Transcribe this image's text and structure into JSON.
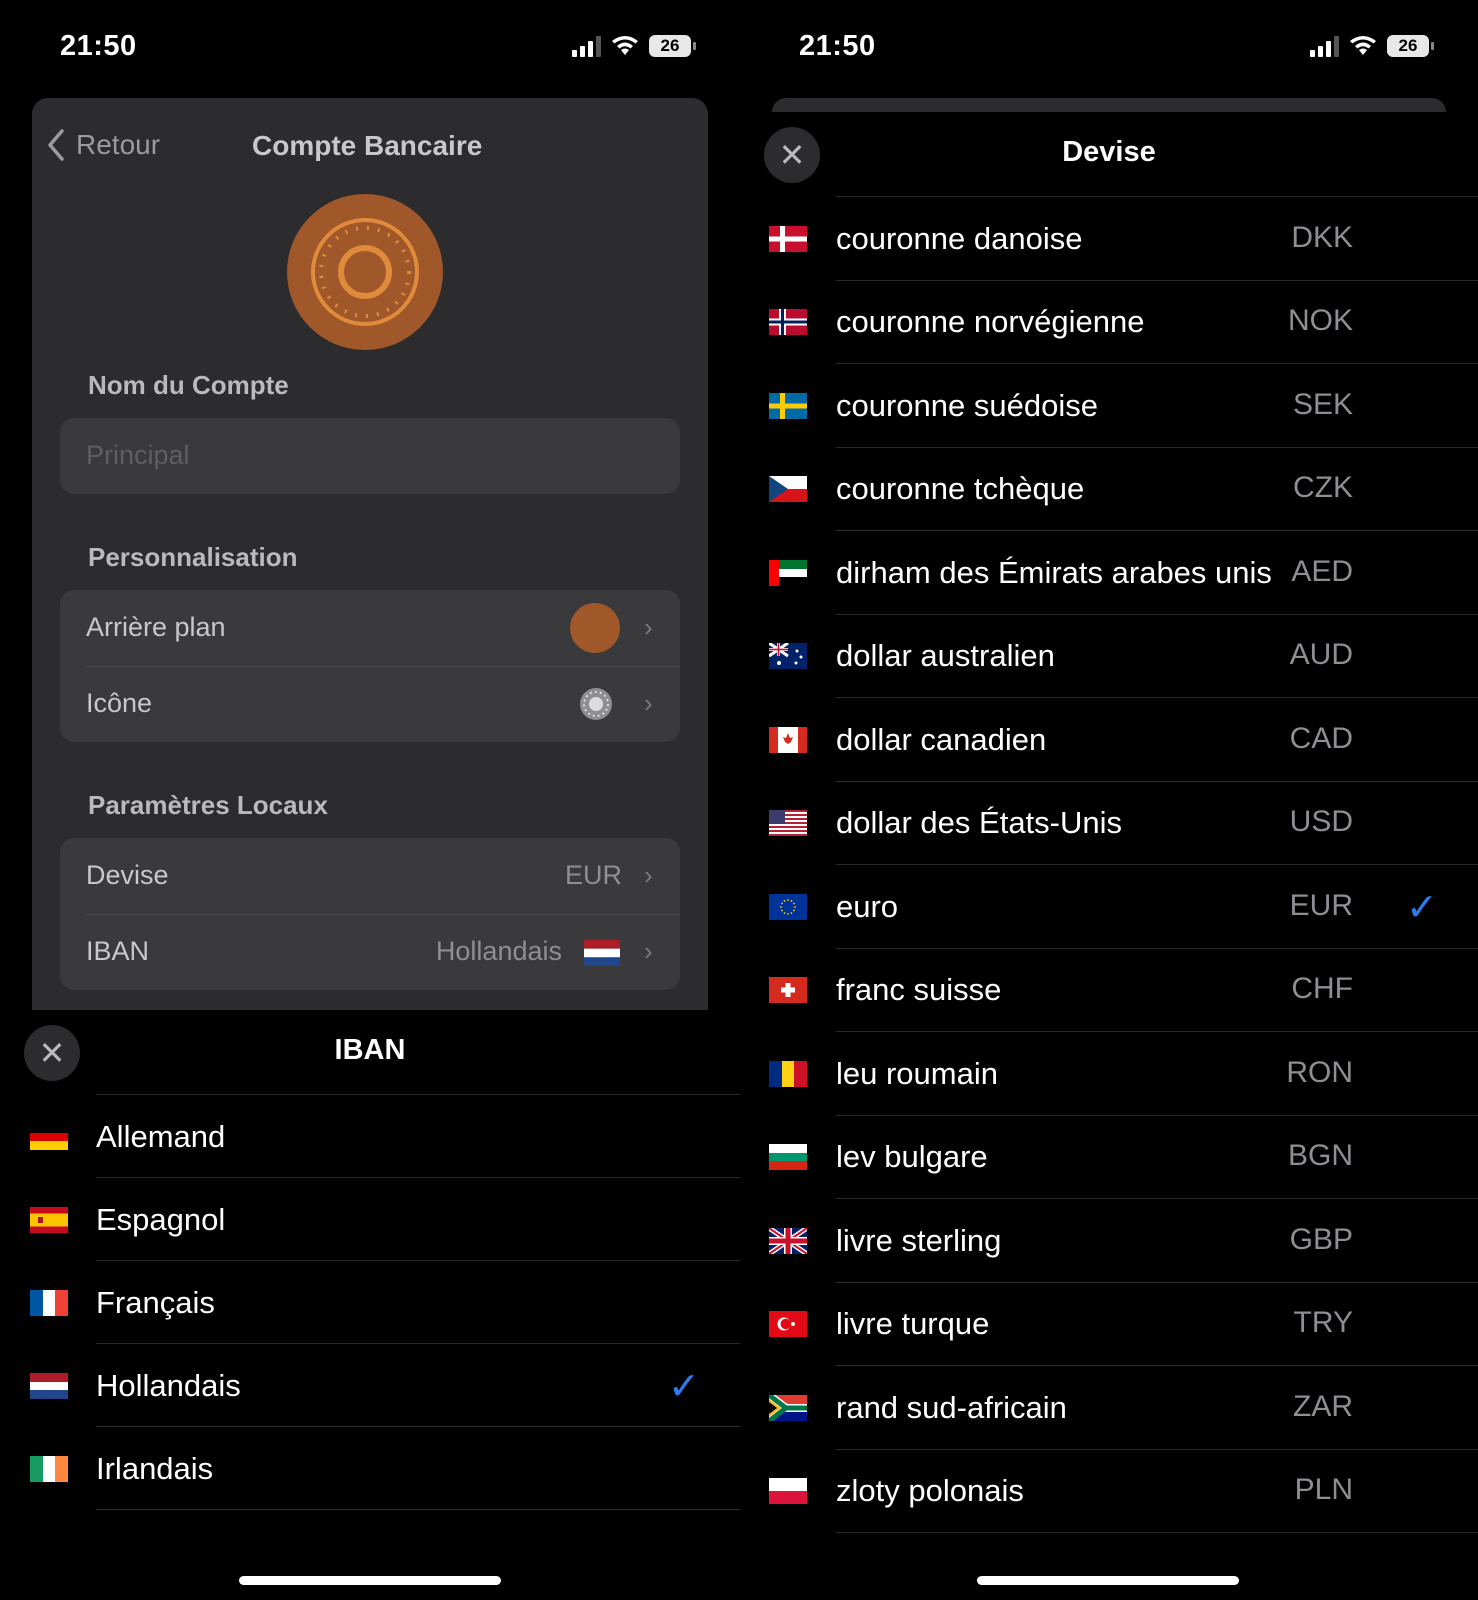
{
  "left": {
    "status": {
      "time": "21:50",
      "battery": "26"
    },
    "nav": {
      "back_label": "Retour",
      "title": "Compte Bancaire"
    },
    "account_name": {
      "label": "Nom du Compte",
      "placeholder": "Principal"
    },
    "personalisation": {
      "label": "Personnalisation",
      "background_label": "Arrière plan",
      "background_color": "#a0582a",
      "icon_label": "Icône"
    },
    "local": {
      "label": "Paramètres Locaux",
      "currency_label": "Devise",
      "currency_value": "EUR",
      "iban_label": "IBAN",
      "iban_value": "Hollandais"
    },
    "iban_sheet": {
      "title": "IBAN",
      "items": [
        {
          "label": "Allemand",
          "flag": "de",
          "selected": false
        },
        {
          "label": "Espagnol",
          "flag": "es",
          "selected": false
        },
        {
          "label": "Français",
          "flag": "fr",
          "selected": false
        },
        {
          "label": "Hollandais",
          "flag": "nl",
          "selected": true
        },
        {
          "label": "Irlandais",
          "flag": "ie",
          "selected": false
        }
      ]
    }
  },
  "right": {
    "status": {
      "time": "21:50",
      "battery": "26"
    },
    "currency_sheet": {
      "title": "Devise",
      "items": [
        {
          "label": "couronne danoise",
          "code": "DKK",
          "flag": "dk",
          "selected": false
        },
        {
          "label": "couronne norvégienne",
          "code": "NOK",
          "flag": "no",
          "selected": false
        },
        {
          "label": "couronne suédoise",
          "code": "SEK",
          "flag": "se",
          "selected": false
        },
        {
          "label": "couronne tchèque",
          "code": "CZK",
          "flag": "cz",
          "selected": false
        },
        {
          "label": "dirham des Émirats arabes unis",
          "code": "AED",
          "flag": "ae",
          "selected": false
        },
        {
          "label": "dollar australien",
          "code": "AUD",
          "flag": "au",
          "selected": false
        },
        {
          "label": "dollar canadien",
          "code": "CAD",
          "flag": "ca",
          "selected": false
        },
        {
          "label": "dollar des États-Unis",
          "code": "USD",
          "flag": "us",
          "selected": false
        },
        {
          "label": "euro",
          "code": "EUR",
          "flag": "eu",
          "selected": true
        },
        {
          "label": "franc suisse",
          "code": "CHF",
          "flag": "ch",
          "selected": false
        },
        {
          "label": "leu roumain",
          "code": "RON",
          "flag": "ro",
          "selected": false
        },
        {
          "label": "lev bulgare",
          "code": "BGN",
          "flag": "bg",
          "selected": false
        },
        {
          "label": "livre sterling",
          "code": "GBP",
          "flag": "gb",
          "selected": false
        },
        {
          "label": "livre turque",
          "code": "TRY",
          "flag": "tr",
          "selected": false
        },
        {
          "label": "rand sud-africain",
          "code": "ZAR",
          "flag": "za",
          "selected": false
        },
        {
          "label": "zloty polonais",
          "code": "PLN",
          "flag": "pl",
          "selected": false
        }
      ]
    }
  },
  "colors": {
    "accent": "#2d7bf0",
    "sheet": "#2c2c2e",
    "group": "#3a3a3c"
  }
}
